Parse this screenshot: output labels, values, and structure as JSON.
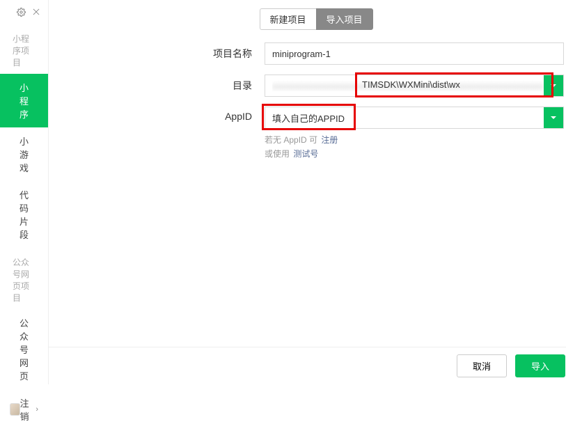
{
  "sidebar": {
    "sections": [
      {
        "title": "小程序项目",
        "items": [
          {
            "label": "小程序",
            "active": true
          },
          {
            "label": "小游戏",
            "active": false
          },
          {
            "label": "代码片段",
            "active": false
          }
        ]
      },
      {
        "title": "公众号网页项目",
        "items": [
          {
            "label": "公众号网页",
            "active": false
          }
        ]
      }
    ],
    "logout": "注销"
  },
  "tabs": {
    "new": "新建项目",
    "import": "导入项目"
  },
  "form": {
    "projectNameLabel": "项目名称",
    "projectNameValue": "miniprogram-1",
    "dirLabel": "目录",
    "dirValueVisible": "TIMSDK\\WXMini\\dist\\wx",
    "appidLabel": "AppID",
    "appidPlaceholder": "填入自己的APPID",
    "hintNoAppid": "若无 AppID 可",
    "hintRegister": "注册",
    "hintOrUse": "或使用",
    "hintTest": "测试号"
  },
  "footer": {
    "cancel": "取消",
    "import": "导入"
  }
}
